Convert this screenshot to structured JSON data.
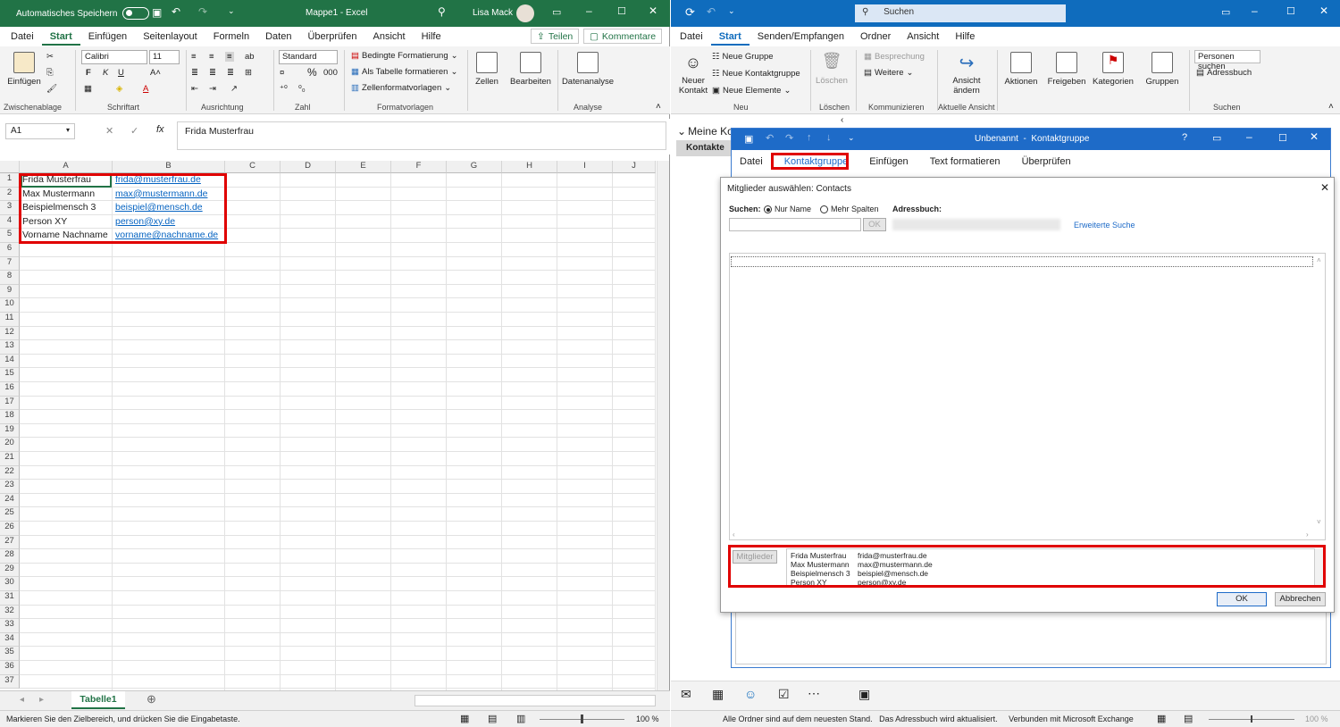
{
  "excel": {
    "autosave_label": "Automatisches Speichern",
    "title": "Mappe1 - Excel",
    "user": "Lisa Mack",
    "menu": [
      "Datei",
      "Start",
      "Einfügen",
      "Seitenlayout",
      "Formeln",
      "Daten",
      "Überprüfen",
      "Ansicht",
      "Hilfe"
    ],
    "share_label": "Teilen",
    "comments_label": "Kommentare",
    "ribbon": {
      "paste_label": "Einfügen",
      "font_name": "Calibri",
      "font_size": "11",
      "number_format": "Standard",
      "cond_format": "Bedingte Formatierung",
      "as_table": "Als Tabelle formatieren",
      "cell_styles": "Zellenformatvorlagen",
      "cells": "Zellen",
      "edit": "Bearbeiten",
      "data_analysis": "Datenanalyse",
      "groups": [
        "Zwischenablage",
        "Schriftart",
        "Ausrichtung",
        "Zahl",
        "Formatvorlagen",
        "Analyse"
      ]
    },
    "namebox": "A1",
    "formula": "Frida Musterfrau",
    "columns": [
      "A",
      "B",
      "C",
      "D",
      "E",
      "F",
      "G",
      "H",
      "I",
      "J"
    ],
    "rows": [
      {
        "name": "Frida Musterfrau",
        "email": "frida@musterfrau.de"
      },
      {
        "name": "Max Mustermann",
        "email": "max@mustermann.de"
      },
      {
        "name": "Beispielmensch 3",
        "email": "beispiel@mensch.de"
      },
      {
        "name": "Person XY",
        "email": "person@xy.de"
      },
      {
        "name": "Vorname Nachname",
        "email": "vorname@nachname.de"
      }
    ],
    "row_count": 37,
    "sheet_tab": "Tabelle1",
    "status": "Markieren Sie den Zielbereich, und drücken Sie die Eingabetaste.",
    "zoom": "100 %"
  },
  "outlook": {
    "search": "Suchen",
    "menu": [
      "Datei",
      "Start",
      "Senden/Empfangen",
      "Ordner",
      "Ansicht",
      "Hilfe"
    ],
    "ribbon": {
      "new_contact": "Neuer Kontakt",
      "new_group": "Neue Gruppe",
      "new_contact_group": "Neue Kontaktgruppe",
      "new_items": "Neue Elemente",
      "delete": "Löschen",
      "meeting": "Besprechung",
      "more": "Weitere",
      "view_change": "Ansicht ändern",
      "actions": "Aktionen",
      "share": "Freigeben",
      "categories": "Kategorien",
      "groups_btn": "Gruppen",
      "find_people": "Personen suchen",
      "address_book": "Adressbuch",
      "groups": [
        "Neu",
        "Löschen",
        "Kommunizieren",
        "Aktuelle Ansicht",
        "Suchen"
      ]
    },
    "folder_title": "Meine Ko",
    "folder_item": "Kontakte",
    "status": "Alle Ordner sind auf dem neuesten Stand.   Das Adressbuch wird aktualisiert.     Verbunden mit Microsoft Exchange",
    "zoom": "100 %"
  },
  "contact_group": {
    "title": "Unbenannt  -  Kontaktgruppe",
    "menu": [
      "Datei",
      "Kontaktgruppe",
      "Einfügen",
      "Text formatieren",
      "Überprüfen"
    ]
  },
  "dialog": {
    "title": "Mitglieder auswählen: Contacts",
    "search_label": "Suchen:",
    "opt_name": "Nur Name",
    "opt_more": "Mehr Spalten",
    "addressbook_label": "Adressbuch:",
    "ok_small": "OK",
    "advanced": "Erweiterte Suche",
    "members_btn": "Mitglieder",
    "members": [
      {
        "name": "Frida Musterfrau",
        "email": "frida@musterfrau.de"
      },
      {
        "name": "Max Mustermann",
        "email": "max@mustermann.de"
      },
      {
        "name": "Beispielmensch 3",
        "email": "beispiel@mensch.de"
      },
      {
        "name": "Person XY",
        "email": "person@xy.de"
      }
    ],
    "ok": "OK",
    "cancel": "Abbrechen"
  }
}
